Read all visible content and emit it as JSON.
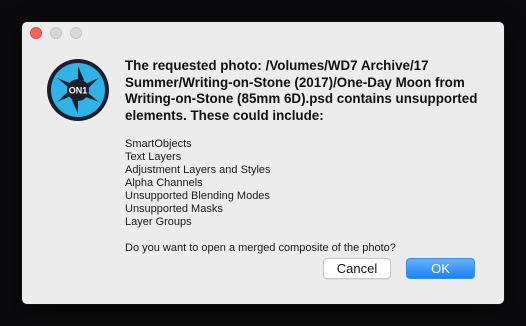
{
  "dialog": {
    "message": "The requested photo: /Volumes/WD7 Archive/17 Summer/Writing-on-Stone (2017)/One-Day Moon from Writing-on-Stone (85mm 6D).psd contains unsupported elements. These could include:",
    "unsupported_items": [
      "SmartObjects",
      "Text Layers",
      "Adjustment Layers and Styles",
      "Alpha Channels",
      "Unsupported Blending Modes",
      "Unsupported Masks",
      "Layer Groups"
    ],
    "question": "Do you want to open a merged composite of the photo?",
    "icon": "on1-app-icon",
    "app_icon_text": "ON1",
    "buttons": {
      "cancel_label": "Cancel",
      "ok_label": "OK"
    }
  },
  "colors": {
    "accent": "#1a82fb",
    "close_button": "#fc605c",
    "icon_ring": "#2fb3e6",
    "icon_center": "#1c1f2b"
  }
}
